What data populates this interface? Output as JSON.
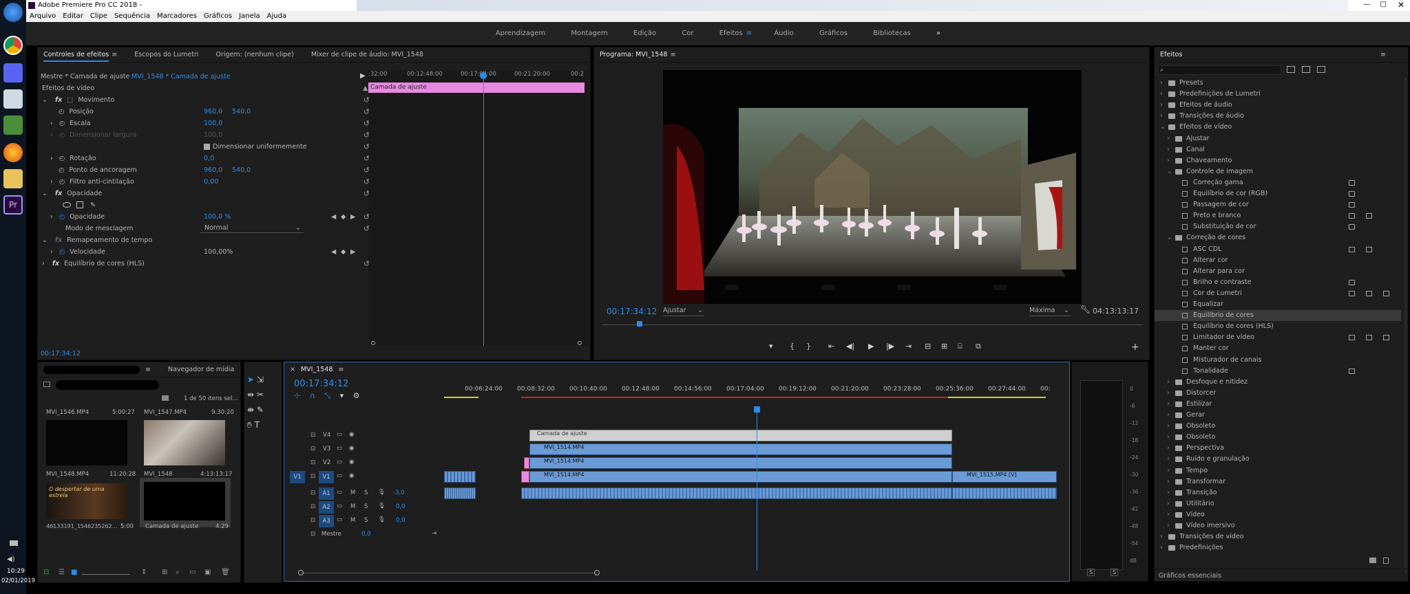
{
  "app": {
    "title": "Adobe Premiere Pro CC 2018 - "
  },
  "menu": [
    "Arquivo",
    "Editar",
    "Clipe",
    "Sequência",
    "Marcadores",
    "Gráficos",
    "Janela",
    "Ajuda"
  ],
  "workspaces": [
    "Aprendizagem",
    "Montagem",
    "Edição",
    "Cor",
    "Efeitos",
    "Áudio",
    "Gráficos",
    "Bibliotecas"
  ],
  "workspaces_more": "»",
  "active_workspace": "Efeitos",
  "taskbar": {
    "time": "10:29",
    "date": "02/01/2019"
  },
  "effect_controls": {
    "tabs": [
      "Controles de efeitos",
      "Escopos do Lumetri",
      "Origem: (nenhum clipe)",
      "Mixer de clipe de áudio: MVI_1548"
    ],
    "master": "Mestre * Camada de ajuste",
    "clip": "MVI_1548 * Camada de ajuste",
    "clip_bar": "Camada de ajuste",
    "ruler": [
      ":32:00",
      "00:12:48:00",
      "00:17:04:00",
      "00:21:20:00",
      "00:2"
    ],
    "rows": [
      {
        "label": "Efeitos de vídeo",
        "indent": 0,
        "values": []
      },
      {
        "label": "Movimento",
        "indent": 1,
        "values": []
      },
      {
        "label": "Posição",
        "indent": 2,
        "values": [
          "960,0",
          "540,0"
        ]
      },
      {
        "label": "Escala",
        "indent": 2,
        "values": [
          "100,0"
        ]
      },
      {
        "label": "Dimensionar largura",
        "indent": 2,
        "values": [
          "100,0"
        ]
      },
      {
        "label": "Dimensionar uniformemente",
        "indent": 2,
        "values": []
      },
      {
        "label": "Rotação",
        "indent": 2,
        "values": [
          "0,0"
        ]
      },
      {
        "label": "Ponto de ancoragem",
        "indent": 2,
        "values": [
          "960,0",
          "540,0"
        ]
      },
      {
        "label": "Filtro anti-cintilação",
        "indent": 2,
        "values": [
          "0,00"
        ]
      },
      {
        "label": "Opacidade",
        "indent": 1,
        "values": []
      },
      {
        "label": "",
        "indent": 2,
        "values": []
      },
      {
        "label": "Opacidade",
        "indent": 2,
        "values": [
          "100,0 %"
        ]
      },
      {
        "label": "Modo de mesclagem",
        "indent": 2,
        "values": [
          "Normal"
        ]
      },
      {
        "label": "Remapeamento de tempo",
        "indent": 1,
        "values": []
      },
      {
        "label": "Velocidade",
        "indent": 2,
        "values": [
          "100,00%"
        ]
      },
      {
        "label": "Equilíbrio de cores (HLS)",
        "indent": 1,
        "values": []
      }
    ],
    "timecode": "00:17:34:12"
  },
  "program": {
    "title": "Programa: MVI_1548",
    "timecode": "00:17:34:12",
    "fit": "Ajustar",
    "quality": "Máxima",
    "duration": "04:13:13:17"
  },
  "project": {
    "tab": "Navegador de mídia",
    "count": "1 de 50 itens sel...",
    "items": [
      {
        "name": "MVI_1546.MP4",
        "dur": "5:00:27"
      },
      {
        "name": "MVI_1547.MP4",
        "dur": "9:30:20"
      },
      {
        "name": "MVI_1548.MP4",
        "dur": "11:20:28"
      },
      {
        "name": "MVI_1548",
        "dur": "4:13:13:17"
      },
      {
        "name": "46133191_1546235262...",
        "dur": "5:00"
      },
      {
        "name": "Camada de ajuste",
        "dur": "4:29"
      }
    ],
    "thumb_text": "O despertar de uma estrela"
  },
  "timeline": {
    "tab": "MVI_1548",
    "timecode": "00:17:34:12",
    "ruler": [
      "00:06:24:00",
      "00:08:32:00",
      "00:10:40:00",
      "00:12:48:00",
      "00:14:56:00",
      "00:17:04:00",
      "00:19:12:00",
      "00:21:20:00",
      "00:23:28:00",
      "00:25:36:00",
      "00:27:44:00",
      "00:"
    ],
    "video_tracks": [
      "V4",
      "V3",
      "V2",
      "V1"
    ],
    "audio_tracks": [
      {
        "name": "A1",
        "vol": "-3,0"
      },
      {
        "name": "A2",
        "vol": "0,0"
      },
      {
        "name": "A3",
        "vol": "0,0"
      }
    ],
    "master": {
      "name": "Mestre",
      "vol": "0,0"
    },
    "clips": {
      "adj": "Camada de ajuste",
      "v3": "MVI_1514.MP4",
      "v2": "MVI_1514.MP4",
      "v1": "MVI_1514.MP4",
      "v1b": "MVI_1515.MP4 [V]"
    },
    "src_patch": "V1",
    "track_letter_m": "M",
    "track_letter_s": "S"
  },
  "meter": {
    "scale": [
      "0",
      "-6",
      "-12",
      "-18",
      "-24",
      "-30",
      "-36",
      "-42",
      "-48",
      "-54",
      "dB"
    ],
    "bottom": [
      "S",
      "S"
    ]
  },
  "effects": {
    "title": "Efeitos",
    "items": [
      {
        "label": "Presets",
        "level": 0,
        "type": "folder",
        "badges": 0
      },
      {
        "label": "Predefinições de Lumetri",
        "level": 0,
        "type": "folder",
        "badges": 0
      },
      {
        "label": "Efeitos de áudio",
        "level": 0,
        "type": "folder",
        "badges": 0
      },
      {
        "label": "Transições de áudio",
        "level": 0,
        "type": "folder",
        "badges": 0
      },
      {
        "label": "Efeitos de vídeo",
        "level": 0,
        "type": "folder",
        "badges": 0
      },
      {
        "label": "Ajustar",
        "level": 1,
        "type": "folder",
        "badges": 0
      },
      {
        "label": "Canal",
        "level": 1,
        "type": "folder",
        "badges": 0
      },
      {
        "label": "Chaveamento",
        "level": 1,
        "type": "folder",
        "badges": 0
      },
      {
        "label": "Controle de imagem",
        "level": 1,
        "type": "folder",
        "badges": 0
      },
      {
        "label": "Correção gama",
        "level": 2,
        "type": "fx",
        "badges": 1
      },
      {
        "label": "Equilíbrio de cor (RGB)",
        "level": 2,
        "type": "fx",
        "badges": 1
      },
      {
        "label": "Passagem de cor",
        "level": 2,
        "type": "fx",
        "badges": 1
      },
      {
        "label": "Preto e branco",
        "level": 2,
        "type": "fx",
        "badges": 2
      },
      {
        "label": "Substituição de cor",
        "level": 2,
        "type": "fx",
        "badges": 1
      },
      {
        "label": "Correção de cores",
        "level": 1,
        "type": "folder",
        "badges": 0
      },
      {
        "label": "ASC CDL",
        "level": 2,
        "type": "fx",
        "badges": 2
      },
      {
        "label": "Alterar cor",
        "level": 2,
        "type": "fx",
        "badges": 0
      },
      {
        "label": "Alterar para cor",
        "level": 2,
        "type": "fx",
        "badges": 0
      },
      {
        "label": "Brilho e contraste",
        "level": 2,
        "type": "fx",
        "badges": 1
      },
      {
        "label": "Cor de Lumetri",
        "level": 2,
        "type": "fx",
        "badges": 3
      },
      {
        "label": "Equalizar",
        "level": 2,
        "type": "fx",
        "badges": 0
      },
      {
        "label": "Equilíbrio de cores",
        "level": 2,
        "type": "fx",
        "badges": 0,
        "selected": true
      },
      {
        "label": "Equilíbrio de cores (HLS)",
        "level": 2,
        "type": "fx",
        "badges": 0
      },
      {
        "label": "Limitador de vídeo",
        "level": 2,
        "type": "fx",
        "badges": 3
      },
      {
        "label": "Manter cor",
        "level": 2,
        "type": "fx",
        "badges": 0
      },
      {
        "label": "Misturador de canais",
        "level": 2,
        "type": "fx",
        "badges": 0
      },
      {
        "label": "Tonalidade",
        "level": 2,
        "type": "fx",
        "badges": 1
      },
      {
        "label": "Desfoque e nitidez",
        "level": 1,
        "type": "folder",
        "badges": 0
      },
      {
        "label": "Distorcer",
        "level": 1,
        "type": "folder",
        "badges": 0
      },
      {
        "label": "Estilizar",
        "level": 1,
        "type": "folder",
        "badges": 0
      },
      {
        "label": "Gerar",
        "level": 1,
        "type": "folder",
        "badges": 0
      },
      {
        "label": "Obsoleto",
        "level": 1,
        "type": "folder",
        "badges": 0
      },
      {
        "label": "Obsoleto",
        "level": 1,
        "type": "folder",
        "badges": 0
      },
      {
        "label": "Perspectiva",
        "level": 1,
        "type": "folder",
        "badges": 0
      },
      {
        "label": "Ruído e granulação",
        "level": 1,
        "type": "folder",
        "badges": 0
      },
      {
        "label": "Tempo",
        "level": 1,
        "type": "folder",
        "badges": 0
      },
      {
        "label": "Transformar",
        "level": 1,
        "type": "folder",
        "badges": 0
      },
      {
        "label": "Transição",
        "level": 1,
        "type": "folder",
        "badges": 0
      },
      {
        "label": "Utilitário",
        "level": 1,
        "type": "folder",
        "badges": 0
      },
      {
        "label": "Vídeo",
        "level": 1,
        "type": "folder",
        "badges": 0
      },
      {
        "label": "Vídeo imersivo",
        "level": 1,
        "type": "folder",
        "badges": 0
      },
      {
        "label": "Transições de vídeo",
        "level": 0,
        "type": "folder",
        "badges": 0
      },
      {
        "label": "Predefinições",
        "level": 0,
        "type": "folder",
        "badges": 0
      }
    ],
    "footer": "Gráficos essenciais"
  },
  "colors": {
    "accent": "#2d8ceb",
    "clip_video": "#6b9bd6",
    "adj_pink": "#e58ae0",
    "panel": "#1e1e1e"
  }
}
